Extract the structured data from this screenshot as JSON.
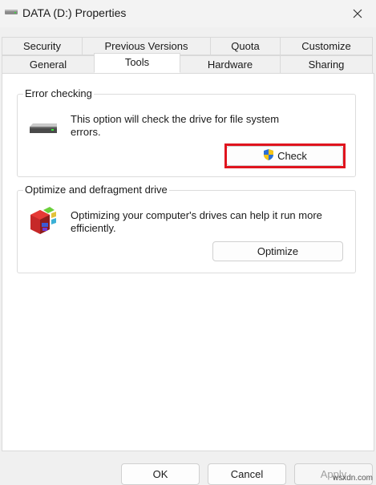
{
  "window": {
    "title": "DATA (D:) Properties"
  },
  "tabs": {
    "row1": [
      "Security",
      "Previous Versions",
      "Quota",
      "Customize"
    ],
    "row2": [
      "General",
      "Tools",
      "Hardware",
      "Sharing"
    ],
    "selected": "Tools"
  },
  "error_checking": {
    "group_label": "Error checking",
    "description_line1": "This option will check the drive for file system",
    "description_line2": "errors.",
    "button_label": "Check",
    "button_icon": "uac-shield-icon",
    "highlight_color": "#e0141e"
  },
  "optimize": {
    "group_label": "Optimize and defragment drive",
    "description_line1": "Optimizing your computer's drives can help it run more",
    "description_line2": "efficiently.",
    "button_label": "Optimize",
    "icon": "defragment-icon"
  },
  "footer": {
    "ok_label": "OK",
    "cancel_label": "Cancel",
    "apply_label": "Apply"
  },
  "watermark": "wsxdn.com"
}
